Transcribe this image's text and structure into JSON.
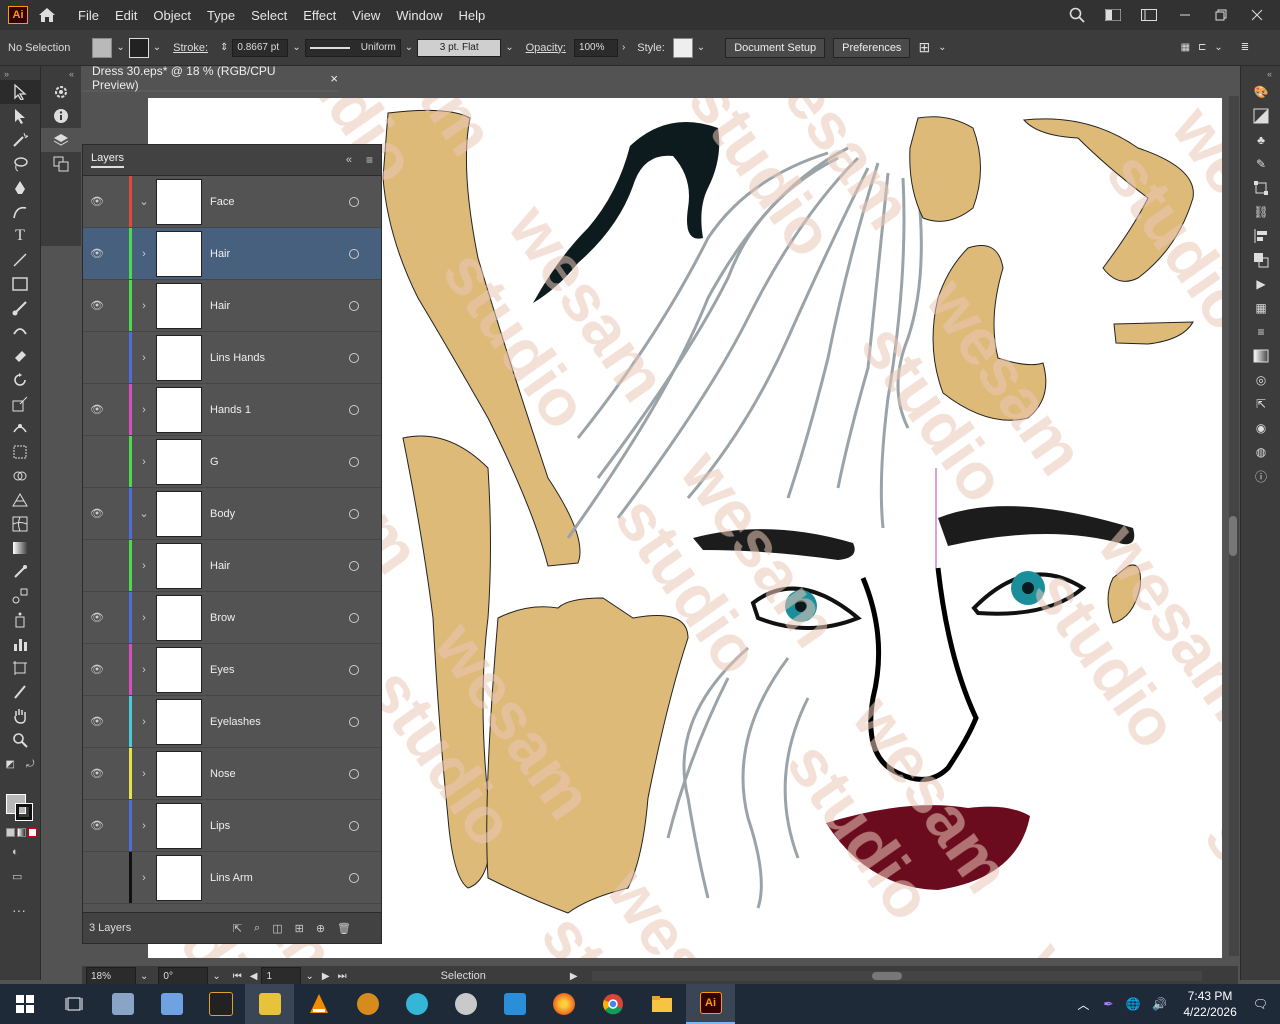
{
  "menubar": {
    "logo": "Ai",
    "items": [
      "File",
      "Edit",
      "Object",
      "Type",
      "Select",
      "Effect",
      "View",
      "Window",
      "Help"
    ]
  },
  "control": {
    "selection": "No Selection",
    "stroke_label": "Stroke:",
    "stroke_value": "0.8667 pt",
    "stroke_profile": "Uniform",
    "brush": "3 pt. Flat",
    "opacity_label": "Opacity:",
    "opacity_value": "100%",
    "style_label": "Style:",
    "doc_setup": "Document Setup",
    "preferences": "Preferences"
  },
  "document": {
    "tab_title": "Dress 30.eps* @ 18 % (RGB/CPU Preview)",
    "close": "×",
    "watermark": "wesam studio"
  },
  "layers_panel": {
    "title": "Layers",
    "rows": [
      {
        "name": "Face",
        "visible": true,
        "expanded": true,
        "color": "#e0483e",
        "selected": false
      },
      {
        "name": "Hair",
        "visible": true,
        "expanded": false,
        "color": "#4cd94c",
        "selected": true
      },
      {
        "name": "Hair",
        "visible": true,
        "expanded": false,
        "color": "#4cd94c",
        "selected": false
      },
      {
        "name": "Lins Hands",
        "visible": false,
        "expanded": false,
        "color": "#4e6dd9",
        "selected": false
      },
      {
        "name": "Hands 1",
        "visible": true,
        "expanded": false,
        "color": "#d94cc2",
        "selected": false
      },
      {
        "name": "G",
        "visible": false,
        "expanded": false,
        "color": "#4cd94c",
        "selected": false
      },
      {
        "name": "Body",
        "visible": true,
        "expanded": true,
        "color": "#4e6dd9",
        "selected": false
      },
      {
        "name": "Hair",
        "visible": false,
        "expanded": false,
        "color": "#4cd94c",
        "selected": false
      },
      {
        "name": "Brow",
        "visible": true,
        "expanded": false,
        "color": "#4e6dd9",
        "selected": false
      },
      {
        "name": "Eyes",
        "visible": true,
        "expanded": false,
        "color": "#d94cc2",
        "selected": false
      },
      {
        "name": "Eyelashes",
        "visible": true,
        "expanded": false,
        "color": "#4cc8d9",
        "selected": false
      },
      {
        "name": "Nose",
        "visible": true,
        "expanded": false,
        "color": "#e6e04c",
        "selected": false
      },
      {
        "name": "Lips",
        "visible": true,
        "expanded": false,
        "color": "#4e6dd9",
        "selected": false
      },
      {
        "name": "Lins Arm",
        "visible": false,
        "expanded": false,
        "color": "#111111",
        "selected": false
      }
    ],
    "footer": "3 Layers"
  },
  "status": {
    "zoom": "18%",
    "rotation": "0°",
    "artboard": "1",
    "tool": "Selection"
  },
  "taskbar": {
    "time": "7:43 PM",
    "date": "4/22/2026"
  }
}
